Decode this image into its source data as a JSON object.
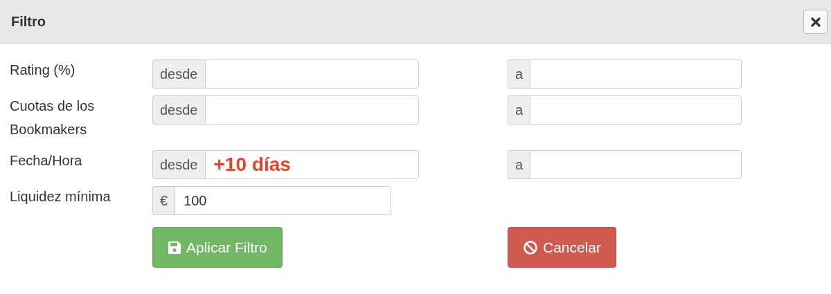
{
  "dialog": {
    "title": "Filtro"
  },
  "rows": [
    {
      "label": "Rating (%)",
      "fields": [
        {
          "addon": "desde"
        },
        {
          "addon": "a"
        }
      ]
    },
    {
      "label": "Cuotas de los Bookmakers",
      "fields": [
        {
          "addon": "desde"
        },
        {
          "addon": "a"
        }
      ]
    },
    {
      "label": "Fecha/Hora",
      "fields": [
        {
          "addon": "desde",
          "value": "+10 días",
          "emphasized": true
        },
        {
          "addon": "a"
        }
      ]
    },
    {
      "label": "Liquidez mínima",
      "fields": [
        {
          "addon": "€",
          "value": "100"
        }
      ]
    }
  ],
  "buttons": [
    {
      "label": "Aplicar Filtro",
      "kind": "apply"
    },
    {
      "label": "Cancelar",
      "kind": "cancel"
    }
  ]
}
